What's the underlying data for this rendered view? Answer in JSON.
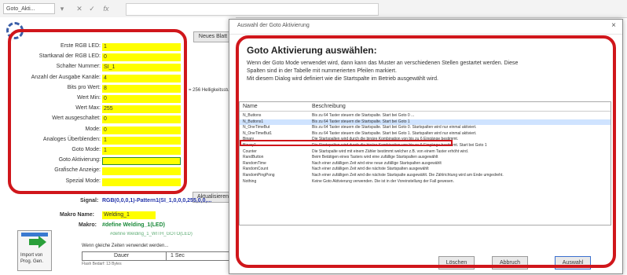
{
  "app": {
    "name_box": "Goto_Akti...",
    "formula_btn_fx": "fx"
  },
  "sheet": {
    "top_button": "Neues Blatt",
    "rows": [
      {
        "label": "Erste RGB LED:",
        "value": "1"
      },
      {
        "label": "Startkanal der RGB LED:",
        "value": "0"
      },
      {
        "label": "Schalter Nummer:",
        "value": "SI_1"
      },
      {
        "label": "Anzahl der Ausgabe Kanäle:",
        "value": "4"
      },
      {
        "label": "Bits pro Wert:",
        "value": "8"
      },
      {
        "label": "Wert Min:",
        "value": "0"
      },
      {
        "label": "Wert Max:",
        "value": "255"
      },
      {
        "label": "Wert ausgeschaltet:",
        "value": "0"
      },
      {
        "label": "Mode:",
        "value": "0"
      },
      {
        "label": "Analoges Überblenden:",
        "value": "1"
      },
      {
        "label": "Goto Mode:",
        "value": "1"
      },
      {
        "label": "Goto Aktivierung:",
        "value": ""
      },
      {
        "label": "Grafische Anzeige:",
        "value": ""
      },
      {
        "label": "Spezial Mode:",
        "value": ""
      }
    ],
    "side_note": "= 256 Helligkeitsstufen",
    "aktualisieren_btn": "Aktualisieren",
    "signal_label": "Signal:",
    "signal_value": "RGB(0,0,0,1)-Pattern1(SI_1,0,0,0,255,0,0,...",
    "makro_label": "Makro Name:",
    "makro_value": "Welding_1",
    "makro2_label": "Makro:",
    "makro2_value": "#define Welding_1(LED)",
    "makro3_value": "#define Welding_1_WITH_GOTO(LED)",
    "grey_note": "Wenn gleiche Zeiten verwendet werden...",
    "table_headers": [
      "Dauer",
      "1 Sec"
    ],
    "table_sub": "Flash Bedarf: 13 Bytes",
    "import_btn_line1": "Import von",
    "import_btn_line2": "Prog. Gen."
  },
  "dialog": {
    "title": "Auswahl der Goto Aktivierung",
    "close": "×",
    "heading": "Goto Aktivierung auswählen:",
    "desc": [
      "Wenn der Goto Mode verwendet wird, dann kann das Muster an verschiedenen Stellen gestartet werden. Diese",
      "Spalten sind in der Tabelle mit nummerierten Pfeilen markiert.",
      "Mit diesem Dialog wird definiert wie die Startspalte im Betrieb ausgewählt wird."
    ],
    "list_headers": {
      "name": "Name",
      "desc": "Beschreibung"
    },
    "list_items": [
      {
        "name": "N_Buttons",
        "desc": "Bis zu 64 Taster steuern die Startspalte. Start bei Goto 0 ..."
      },
      {
        "name": "N_Buttons1",
        "desc": "Bis zu 64 Taster steuern die Startspalte. Start bei Goto 1"
      },
      {
        "name": "N_OneTimeBut",
        "desc": "Bis zu 64 Taster steuern die Startspalte. Start bei Goto 0. Startspalten wird nur einmal aktiviert."
      },
      {
        "name": "N_OneTimeBut1",
        "desc": "Bis zu 64 Taster steuern die Startspalte. Start bei Goto 1. Startspalten wird nur einmal aktiviert."
      },
      {
        "name": "Binary",
        "desc": "Die Startspalten wird durch die binäre Kombination von bis zu 6 Eingänge bestimmt."
      },
      {
        "name": "Binary1",
        "desc": "Die Startspalten wird durch die binäre Kombination von bis zu 6 Eingänge bestimmt. Start bei Goto 1"
      },
      {
        "name": "Counter",
        "desc": "Die Startspalte wird mit einem Zähler bestimmt welcher z.B. von einem Taster erhöht wird."
      },
      {
        "name": "RandButton",
        "desc": "Beim Betätigen eines Tasters wird eine zufällige Startspalten ausgewählt"
      },
      {
        "name": "RandomTime",
        "desc": "Nach einer zufälligen Zeit wird eine neue zufällige Startspalten ausgewählt"
      },
      {
        "name": "RandomCount",
        "desc": "Nach einer zufälligen Zeit wird die nächste Startspalten ausgewählt"
      },
      {
        "name": "RandomPingPong",
        "desc": "Nach einer zufälligen Zeit wird die nächste Startspalte ausgewählt. Die Zählrichtung wird am Ende umgedreht."
      },
      {
        "name": "Nothing",
        "desc": "Keine Goto Aktivierung verwenden. Die ist in der Voreinstellung der Fall gewesen."
      }
    ],
    "btn_loeschen": "Löschen",
    "btn_abbruch": "Abbruch",
    "btn_auswahl": "Auswahl"
  },
  "colors": {
    "highlight_red": "#d0161b",
    "cell_yellow": "#ffff00",
    "signal_blue": "#2233aa",
    "makro_green": "#1a8a3a"
  }
}
